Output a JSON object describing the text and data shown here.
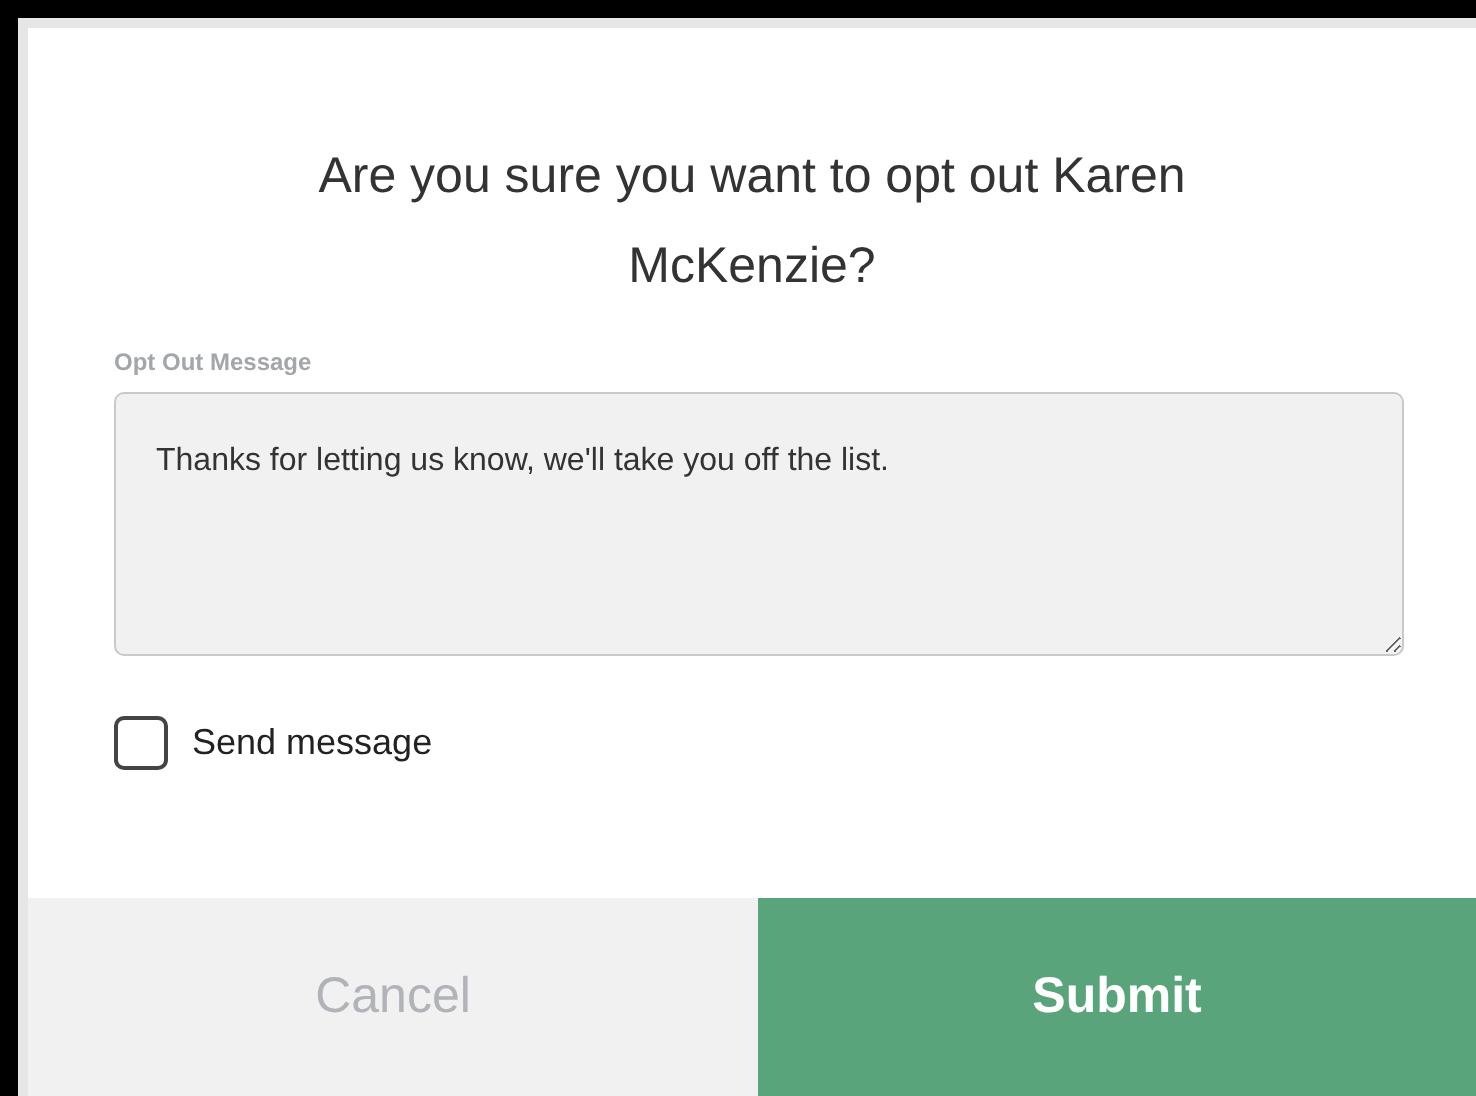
{
  "dialog": {
    "title": "Are you sure you want to opt out Karen McKenzie?",
    "message_label": "Opt Out Message",
    "message_value": "Thanks for letting us know, we'll take you off the list.",
    "send_message": {
      "label": "Send message",
      "checked": false
    },
    "buttons": [
      {
        "label": "Cancel",
        "kind": "secondary"
      },
      {
        "label": "Submit",
        "kind": "primary"
      }
    ]
  }
}
